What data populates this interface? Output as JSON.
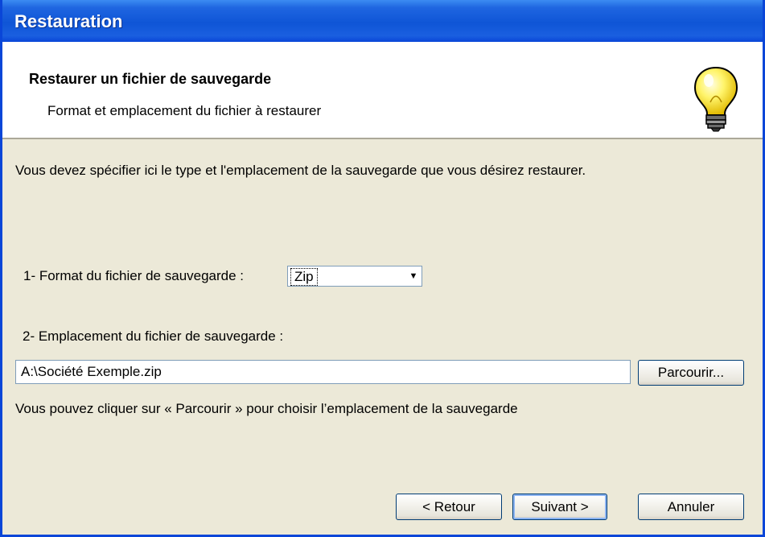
{
  "window": {
    "title": "Restauration"
  },
  "header": {
    "heading": "Restaurer un fichier de sauvegarde",
    "subheading": "Format et emplacement du fichier à restaurer",
    "icon": "lightbulb-icon"
  },
  "body": {
    "intro": "Vous devez spécifier ici le type et l'emplacement de la sauvegarde que vous désirez restaurer.",
    "format_label": "1- Format du fichier de sauvegarde :",
    "format_value": "Zip",
    "location_label": "2- Emplacement du fichier de sauvegarde :",
    "location_value": "A:\\Société Exemple.zip",
    "browse_label": "Parcourir...",
    "hint": "Vous pouvez cliquer sur « Parcourir » pour choisir l’emplacement de la sauvegarde"
  },
  "footer": {
    "back_label": "< Retour",
    "next_label": "Suivant >",
    "cancel_label": "Annuler"
  },
  "colors": {
    "titlebar": "#0f55d6",
    "dialog_bg": "#ece9d8",
    "button_border": "#003c74"
  }
}
